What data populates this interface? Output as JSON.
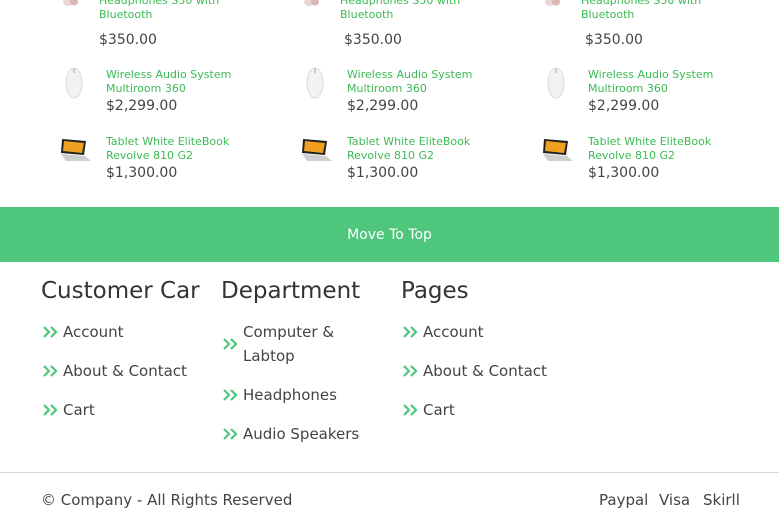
{
  "products": {
    "columns": [
      {
        "items": [
          {
            "name": "Headphones S50 with Bluetooth",
            "price": "$350.00",
            "icon": "headphones-icon"
          },
          {
            "name": "Wireless Audio System Multiroom 360",
            "price": "$2,299.00",
            "icon": "speaker-icon"
          },
          {
            "name": "Tablet White EliteBook Revolve 810 G2",
            "price": "$1,300.00",
            "icon": "laptop-icon"
          }
        ]
      },
      {
        "items": [
          {
            "name": "Headphones S50 with Bluetooth",
            "price": "$350.00",
            "icon": "headphones-icon"
          },
          {
            "name": "Wireless Audio System Multiroom 360",
            "price": "$2,299.00",
            "icon": "speaker-icon"
          },
          {
            "name": "Tablet White EliteBook Revolve 810 G2",
            "price": "$1,300.00",
            "icon": "laptop-icon"
          }
        ]
      },
      {
        "items": [
          {
            "name": "Headphones S50 with Bluetooth",
            "price": "$350.00",
            "icon": "headphones-icon"
          },
          {
            "name": "Wireless Audio System Multiroom 360",
            "price": "$2,299.00",
            "icon": "speaker-icon"
          },
          {
            "name": "Tablet White EliteBook Revolve 810 G2",
            "price": "$1,300.00",
            "icon": "laptop-icon"
          }
        ]
      }
    ]
  },
  "move_to_top": "Move To Top",
  "footer": {
    "customer": {
      "title": "Customer Car",
      "links": [
        "Account",
        "About & Contact",
        "Cart"
      ]
    },
    "department": {
      "title": "Department",
      "links": [
        "Computer & Labtop",
        "Headphones",
        "Audio Speakers"
      ]
    },
    "pages": {
      "title": "Pages",
      "links": [
        "Account",
        "About & Contact",
        "Cart"
      ]
    }
  },
  "bottom": {
    "copyright": "© Company - All Rights Reserved",
    "payments": [
      "Paypal",
      "Visa",
      "Skirll"
    ]
  },
  "colors": {
    "accent": "#4ec67b",
    "link_green": "#3cba54"
  }
}
